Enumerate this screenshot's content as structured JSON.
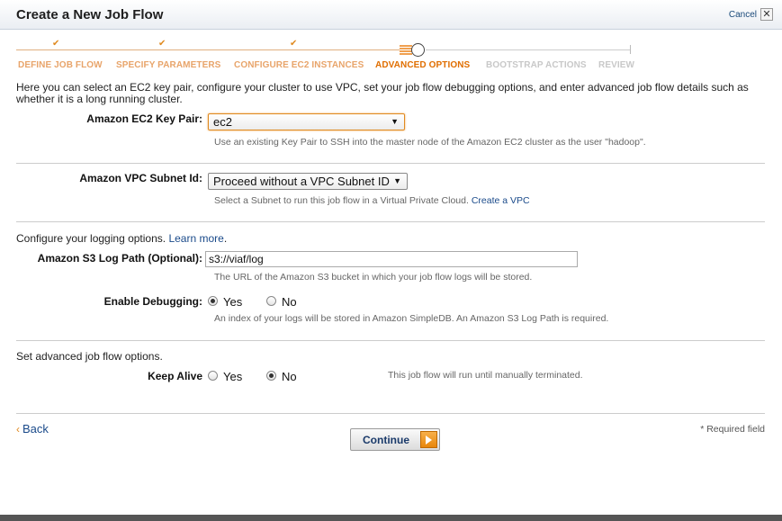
{
  "dialog": {
    "title": "Create a New Job Flow",
    "cancel_label": "Cancel",
    "close_glyph": "✕"
  },
  "wizard": {
    "steps": [
      {
        "label": "DEFINE JOB FLOW",
        "state": "done"
      },
      {
        "label": "SPECIFY PARAMETERS",
        "state": "done"
      },
      {
        "label": "CONFIGURE EC2 INSTANCES",
        "state": "done"
      },
      {
        "label": "ADVANCED OPTIONS",
        "state": "active"
      },
      {
        "label": "BOOTSTRAP ACTIONS",
        "state": "todo"
      },
      {
        "label": "REVIEW",
        "state": "todo"
      }
    ],
    "check_glyph": "✔"
  },
  "intro_text": "Here you can select an EC2 key pair, configure your cluster to use VPC, set your job flow debugging options, and enter advanced job flow details such as whether it is a long running cluster.",
  "key_pair": {
    "label": "Amazon EC2 Key Pair:",
    "value": "ec2",
    "help": "Use an existing Key Pair to SSH into the master node of the Amazon EC2 cluster as the user \"hadoop\"."
  },
  "vpc": {
    "label": "Amazon VPC Subnet Id:",
    "value": "Proceed without a VPC Subnet ID",
    "help": "Select a Subnet to run this job flow in a Virtual Private Cloud.",
    "help_link": "Create a VPC"
  },
  "logging": {
    "section_text": "Configure your logging options.",
    "learn_more": "Learn more",
    "s3_label": "Amazon S3 Log Path (Optional):",
    "s3_value": "s3://viaf/log",
    "s3_help": "The URL of the Amazon S3 bucket in which your job flow logs will be stored.",
    "debug_label": "Enable Debugging:",
    "debug_yes": "Yes",
    "debug_no": "No",
    "debug_selected": "Yes",
    "debug_help": "An index of your logs will be stored in Amazon SimpleDB. An Amazon S3 Log Path is required."
  },
  "advanced": {
    "section_text": "Set advanced job flow options.",
    "keep_alive_label": "Keep Alive",
    "yes": "Yes",
    "no": "No",
    "selected": "No",
    "help": "This job flow will run until manually terminated."
  },
  "footer": {
    "back_chevron": "‹",
    "back_label": "Back",
    "continue_label": "Continue",
    "required_note": "* Required field"
  },
  "colors": {
    "accent": "#e06e00",
    "link": "#1a4a8a"
  }
}
